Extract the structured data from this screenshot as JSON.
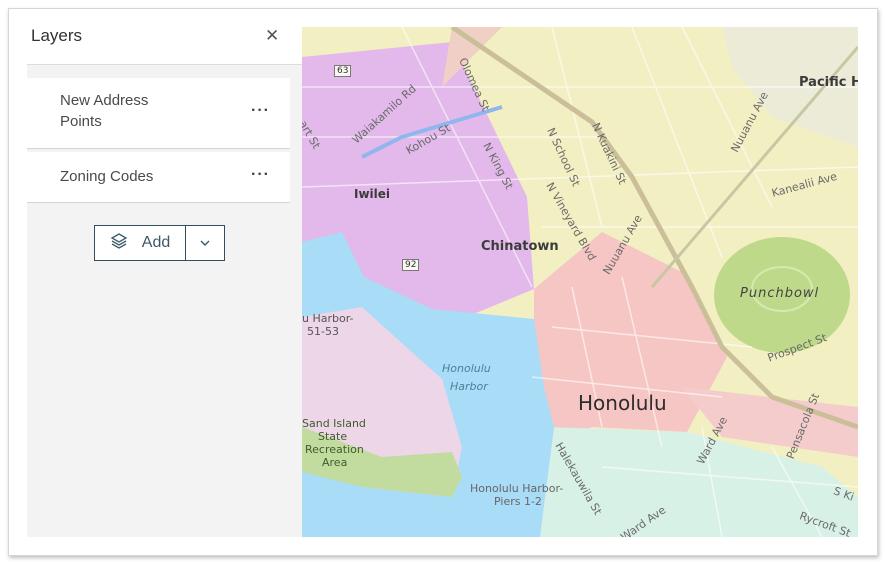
{
  "panel": {
    "title": "Layers",
    "close_icon": "close-icon",
    "layers": [
      {
        "label": "New Address Points",
        "line1": "New Address",
        "line2": "Points",
        "more": "···"
      },
      {
        "label": "Zoning Codes",
        "more": "···"
      }
    ],
    "add_label": "Add",
    "add_icon": "layers-icon",
    "dropdown_icon": "chevron-down-icon"
  },
  "map": {
    "badges": [
      "63",
      "92"
    ],
    "places": {
      "pacific": "Pacific H",
      "iwilei": "Iwilei",
      "chinatown": "Chinatown",
      "punchbowl": "Punchbowl",
      "honolulu": "Honolulu",
      "harbor1": "Honolulu",
      "harbor2": "Harbor",
      "piers51a": "u Harbor-",
      "piers51b": "51-53",
      "sand1": "Sand Island",
      "sand2": "State",
      "sand3": "Recreation",
      "sand4": "Area",
      "piers12a": "Honolulu Harbor-",
      "piers12b": "Piers 1-2"
    },
    "streets": {
      "hart": "art St",
      "waiakamilo": "Waiakamilo Rd",
      "kohou": "Kohou St",
      "olomea": "Olomea St",
      "nking": "N King St",
      "nschool": "N School St",
      "nkuakini": "N Kuakini St",
      "nuuanu1": "Nuuanu Ave",
      "kanealii": "Kanealii Ave",
      "vineyard": "N Vineyard Blvd",
      "nuuanu2": "Nuuanu Ave",
      "prospect": "Prospect St",
      "halekauwila": "Halekauwila St",
      "ward1": "Ward Ave",
      "pensacola": "Pensacola St",
      "ward2": "Ward Ave",
      "ski": "S Ki",
      "rycroft": "Rycroft St"
    }
  }
}
